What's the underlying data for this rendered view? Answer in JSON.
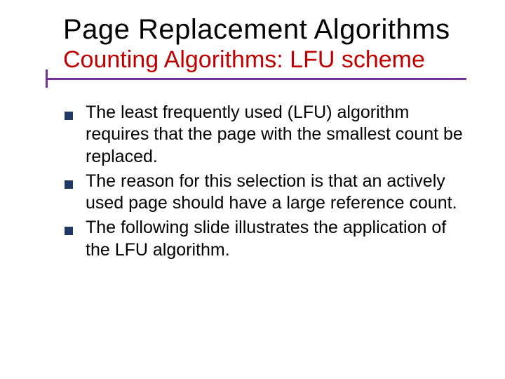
{
  "header": {
    "title": "Page Replacement Algorithms",
    "subtitle": "Counting Algorithms: LFU scheme"
  },
  "bullets": [
    "The least frequently used (LFU) algorithm requires that the page with the smallest count be replaced.",
    "The reason for this selection is that an actively used page should have a large reference count.",
    "The following slide illustrates the application of the LFU algorithm."
  ],
  "theme": {
    "accent": "#7030a0",
    "bullet_color": "#1f3864",
    "subtitle_color": "#c00000"
  }
}
